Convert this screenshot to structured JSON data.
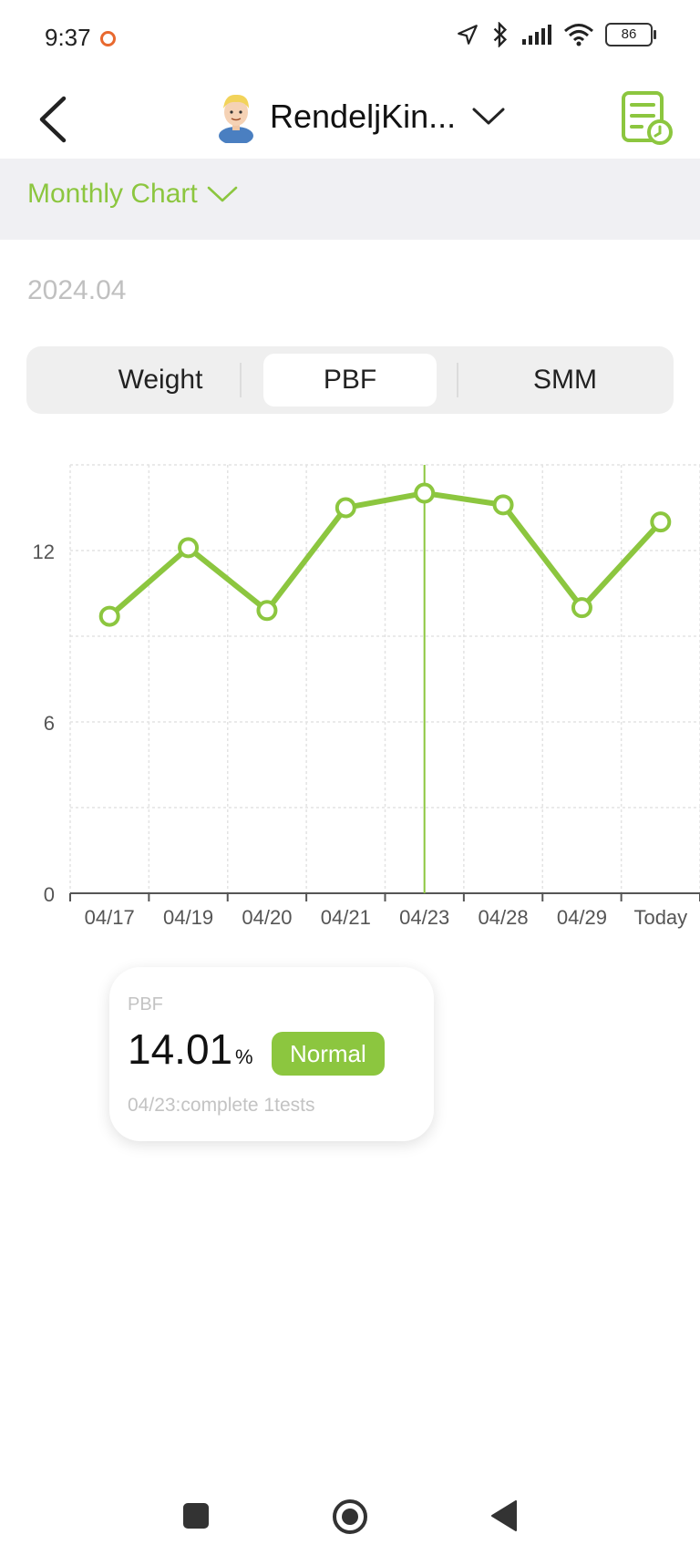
{
  "status_bar": {
    "time": "9:37",
    "battery": "86"
  },
  "nav": {
    "profile_name": "RendeljKin..."
  },
  "chart_type": {
    "label": "Monthly Chart"
  },
  "month": "2024.04",
  "tabs": [
    {
      "label": "Weight",
      "selected": false
    },
    {
      "label": "PBF",
      "selected": true
    },
    {
      "label": "SMM",
      "selected": false
    }
  ],
  "chart_data": {
    "type": "line",
    "categories": [
      "04/17",
      "04/19",
      "04/20",
      "04/21",
      "04/23",
      "04/28",
      "04/29",
      "Today"
    ],
    "series": [
      {
        "values": [
          9.7,
          12.1,
          9.9,
          13.5,
          14.01,
          13.6,
          10.0,
          13.0
        ]
      }
    ],
    "y_ticks": [
      "0",
      "6",
      "12"
    ],
    "ylim": [
      0,
      15
    ],
    "selected_index": 4,
    "color": "#8cc63f",
    "grid": true
  },
  "card": {
    "metric": "PBF",
    "value": "14.01",
    "unit": "%",
    "status": "Normal",
    "note": "04/23:complete 1tests"
  },
  "icons": [
    "back-arrow-icon",
    "avatar-icon",
    "chevron-down-icon",
    "report-history-icon",
    "square-nav-icon",
    "home-circle-icon",
    "triangle-back-icon"
  ]
}
